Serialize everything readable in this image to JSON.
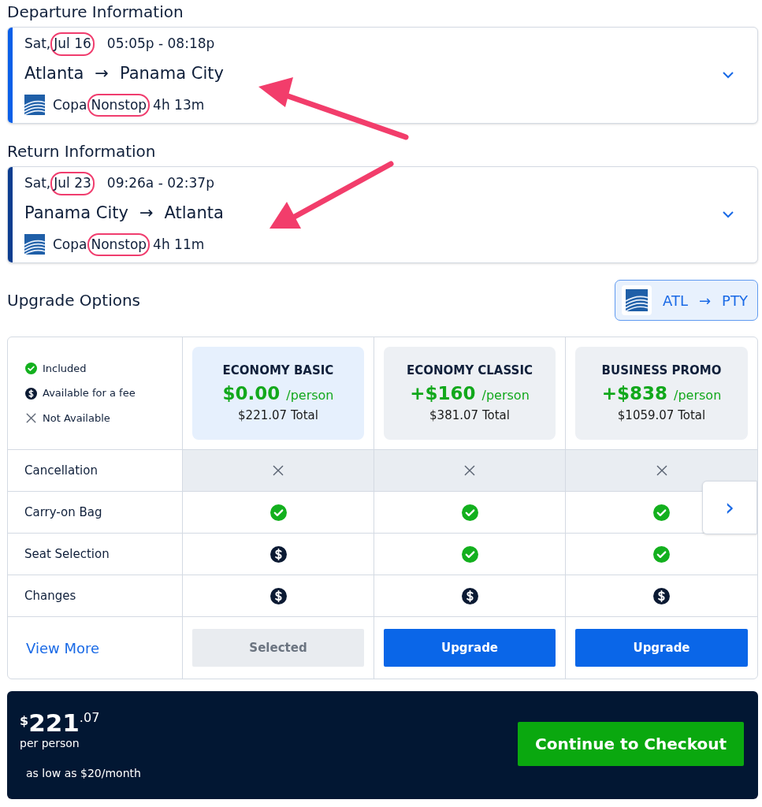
{
  "flights": [
    {
      "heading": "Departure Information",
      "day": "Sat,",
      "date": "Jul 16",
      "date_circled": true,
      "times": "05:05p - 08:18p",
      "from": "Atlanta",
      "arrow": "→",
      "to": "Panama City",
      "airline": "Copa",
      "stops": "Nonstop",
      "stops_circled": true,
      "duration": "4h 13m",
      "color": "#0a5fe8"
    },
    {
      "heading": "Return Information",
      "day": "Sat,",
      "date": "Jul 23",
      "date_circled": true,
      "times": "09:26a - 02:37p",
      "from": "Panama City",
      "arrow": "→",
      "to": "Atlanta",
      "airline": "Copa",
      "stops": "Nonstop",
      "stops_circled": true,
      "duration": "4h 11m",
      "color": "#0c3d8f"
    }
  ],
  "upgrade": {
    "title": "Upgrade Options",
    "route": {
      "from": "ATL",
      "arrow": "→",
      "to": "PTY"
    }
  },
  "legend": [
    {
      "kind": "check",
      "label": "Included"
    },
    {
      "kind": "fee",
      "label": "Available for a fee"
    },
    {
      "kind": "x",
      "label": "Not Available"
    }
  ],
  "fares": [
    {
      "name": "ECONOMY BASIC",
      "price": "$0.00",
      "unit": "/person",
      "total": "$221.07 Total",
      "selected": true,
      "button": "Selected"
    },
    {
      "name": "ECONOMY CLASSIC",
      "price": "+$160",
      "unit": "/person",
      "total": "$381.07 Total",
      "selected": false,
      "button": "Upgrade"
    },
    {
      "name": "BUSINESS PROMO",
      "price": "+$838",
      "unit": "/person",
      "total": "$1059.07 Total",
      "selected": false,
      "button": "Upgrade"
    }
  ],
  "features": [
    {
      "label": "Cancellation",
      "highlighted": true,
      "values": [
        {
          "kind": "x"
        },
        {
          "kind": "x"
        },
        {
          "kind": "x"
        }
      ]
    },
    {
      "label": "Carry-on Bag",
      "highlighted": false,
      "values": [
        {
          "kind": "check"
        },
        {
          "kind": "check"
        },
        {
          "kind": "check"
        }
      ]
    },
    {
      "label": "Seat Selection",
      "highlighted": false,
      "values": [
        {
          "kind": "fee"
        },
        {
          "kind": "check"
        },
        {
          "kind": "check"
        }
      ]
    },
    {
      "label": "Changes",
      "highlighted": false,
      "values": [
        {
          "kind": "fee"
        },
        {
          "kind": "fee"
        },
        {
          "kind": "fee"
        }
      ]
    }
  ],
  "view_more": "View More",
  "next_arrow": "›",
  "summary": {
    "currency": "$",
    "whole": "221",
    "cents": ".07",
    "per": "per person",
    "financing": "as low as $20/month",
    "checkout": "Continue to Checkout"
  }
}
